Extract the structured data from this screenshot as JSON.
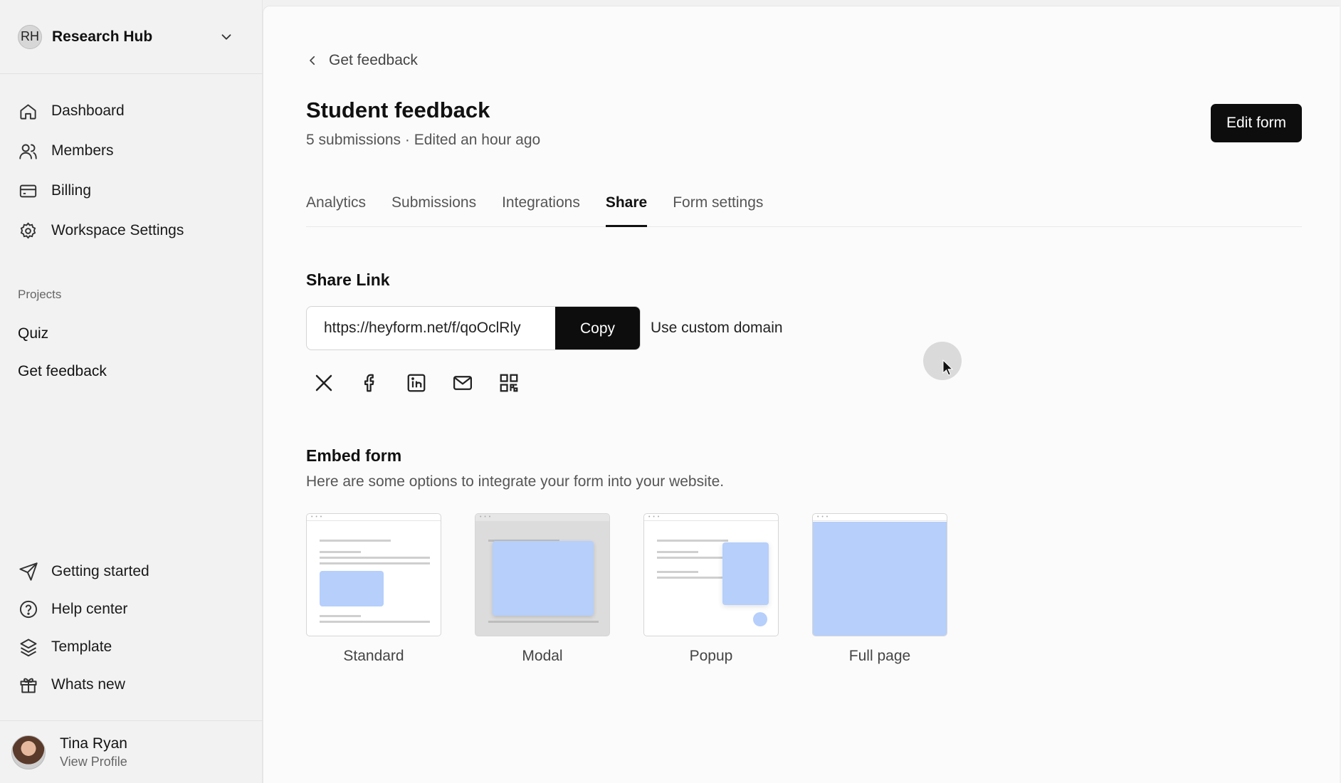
{
  "workspace": {
    "initials": "RH",
    "name": "Research Hub"
  },
  "nav": {
    "items": [
      {
        "label": "Dashboard",
        "icon": "home-icon"
      },
      {
        "label": "Members",
        "icon": "users-icon"
      },
      {
        "label": "Billing",
        "icon": "credit-card-icon"
      },
      {
        "label": "Workspace Settings",
        "icon": "gear-icon"
      }
    ]
  },
  "projects": {
    "label": "Projects",
    "items": [
      "Quiz",
      "Get feedback"
    ]
  },
  "bottom_nav": {
    "items": [
      {
        "label": "Getting started",
        "icon": "send-icon"
      },
      {
        "label": "Help center",
        "icon": "help-circle-icon"
      },
      {
        "label": "Template",
        "icon": "layers-icon"
      },
      {
        "label": "Whats new",
        "icon": "gift-icon"
      }
    ]
  },
  "profile": {
    "name": "Tina Ryan",
    "link": "View Profile"
  },
  "header": {
    "back": "Get feedback",
    "title": "Student feedback",
    "subtitle": "5 submissions · Edited an hour ago",
    "edit_button": "Edit form"
  },
  "tabs": [
    "Analytics",
    "Submissions",
    "Integrations",
    "Share",
    "Form settings"
  ],
  "active_tab": "Share",
  "share": {
    "heading": "Share Link",
    "url": "https://heyform.net/f/qoOclRly",
    "copy_button": "Copy",
    "custom_domain": "Use custom domain",
    "socials": [
      "x-icon",
      "facebook-icon",
      "linkedin-icon",
      "mail-icon",
      "qr-code-icon"
    ]
  },
  "embed": {
    "heading": "Embed form",
    "description": "Here are some options to integrate your form into your website.",
    "options": [
      "Standard",
      "Modal",
      "Popup",
      "Full page"
    ]
  },
  "colors": {
    "accent": "#0d0d0d",
    "embed_blue": "#b6cffb"
  }
}
